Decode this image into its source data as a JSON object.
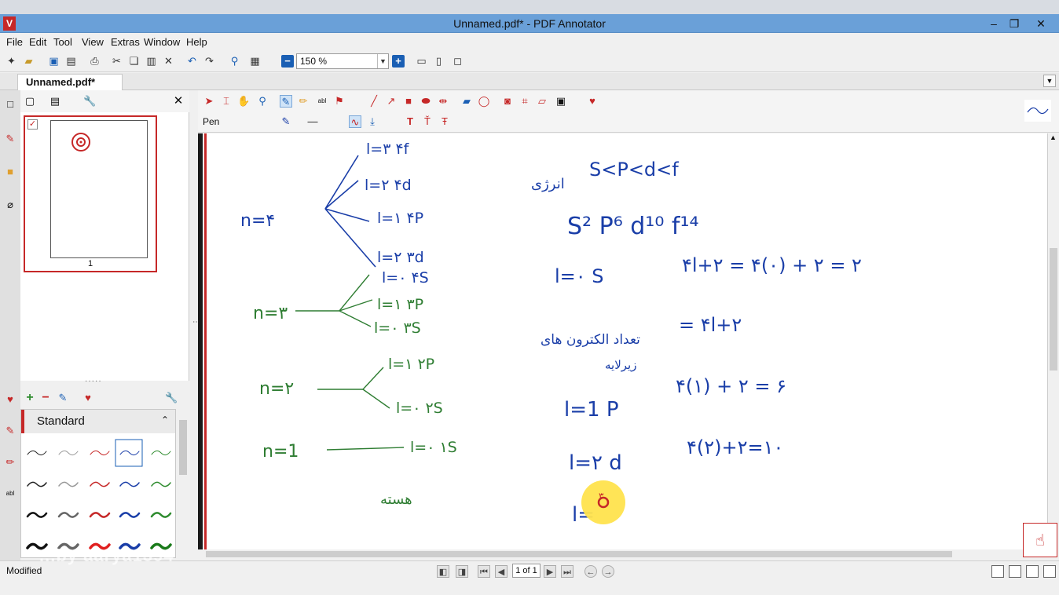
{
  "window": {
    "title": "Unnamed.pdf* - PDF Annotator",
    "app_icon": "pdf-annotator-icon"
  },
  "menu": {
    "file": "File",
    "edit": "Edit",
    "tool": "Tool",
    "view": "View",
    "extras": "Extras",
    "window": "Window",
    "help": "Help"
  },
  "toolbar": {
    "zoom": "150 %"
  },
  "tab": {
    "name": "Unnamed.pdf*"
  },
  "thumbnails": {
    "page_number": "1"
  },
  "pen_panel": {
    "group_name": "Standard"
  },
  "main_toolbar": {
    "tool_label": "Pen"
  },
  "document": {
    "handwritten": {
      "tree_n4": "n=۴",
      "tree_n3": "n=۳",
      "tree_n2": "n=۲",
      "tree_n1": "n=1",
      "n4_l3": "l=۳  ۴f",
      "n4_l2": "l=۲  ۴d",
      "n4_l1": "l=۱  ۴P",
      "n3_l2": "l=۲  ۳d",
      "n3_l0a": "l=۰  ۴S",
      "n3_l1": "l=۱  ۳P",
      "n3_l0": "l=۰  ۳S",
      "n2_l1": "l=۱  ۲P",
      "n2_l0": "l=۰  ۲S",
      "n1_l0": "l=۰  ۱S",
      "nucleus": "هسته",
      "order_persian": "انرژی",
      "order": "S<P<d<f",
      "capacity": "S² P⁶ d¹⁰ f¹⁴",
      "row_s_left": "l=۰  S",
      "row_s_right": "۴l+۲ = ۴(۰) + ۲ = ۲",
      "orbitals_persian": "تعداد الکترون های",
      "orbitals_persian2": "زیرلایه",
      "orbitals_formula": "= ۴l+۲",
      "row_p_left": "l=1  P",
      "row_p_right": "۴(۱) + ۲ = ۶",
      "row_d_left": "l=۲  d",
      "row_d_right": "۴(۲)+۲=۱۰",
      "row_f_left": "l=",
      "cursor_glyph": "۳"
    }
  },
  "status": {
    "text": "Modified",
    "page": "1 of 1"
  },
  "watermark": "...by aarya1394"
}
